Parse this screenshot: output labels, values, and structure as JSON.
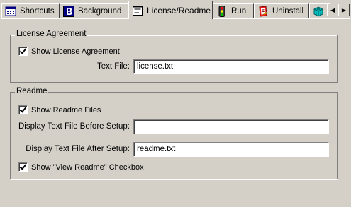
{
  "tabs": [
    {
      "label": "Shortcuts",
      "icon": "calendar-grid-icon"
    },
    {
      "label": "Background",
      "icon": "letter-b-icon"
    },
    {
      "label": "License/Readme",
      "icon": "notepad-icon",
      "selected": true
    },
    {
      "label": "Run",
      "icon": "traffic-light-icon"
    },
    {
      "label": "Uninstall",
      "icon": "uninstall-icon"
    },
    {
      "label": "",
      "icon": "cube-grid-icon"
    }
  ],
  "tab_scroll": {
    "left": "◀",
    "right": "▶"
  },
  "license": {
    "title": "License Agreement",
    "show_label": "Show License Agreement",
    "show_checked": true,
    "text_file_label": "Text File:",
    "text_file_value": "license.txt"
  },
  "readme": {
    "title": "Readme",
    "show_label": "Show Readme Files",
    "show_checked": true,
    "before_label": "Display Text File Before Setup:",
    "before_value": "",
    "after_label": "Display Text File After Setup:",
    "after_value": "readme.txt",
    "view_checkbox_label": "Show \"View Readme\" Checkbox",
    "view_checkbox_checked": true
  },
  "colors": {
    "window": "#d4d0c8",
    "field": "#ffffff",
    "shadow": "#808080"
  }
}
